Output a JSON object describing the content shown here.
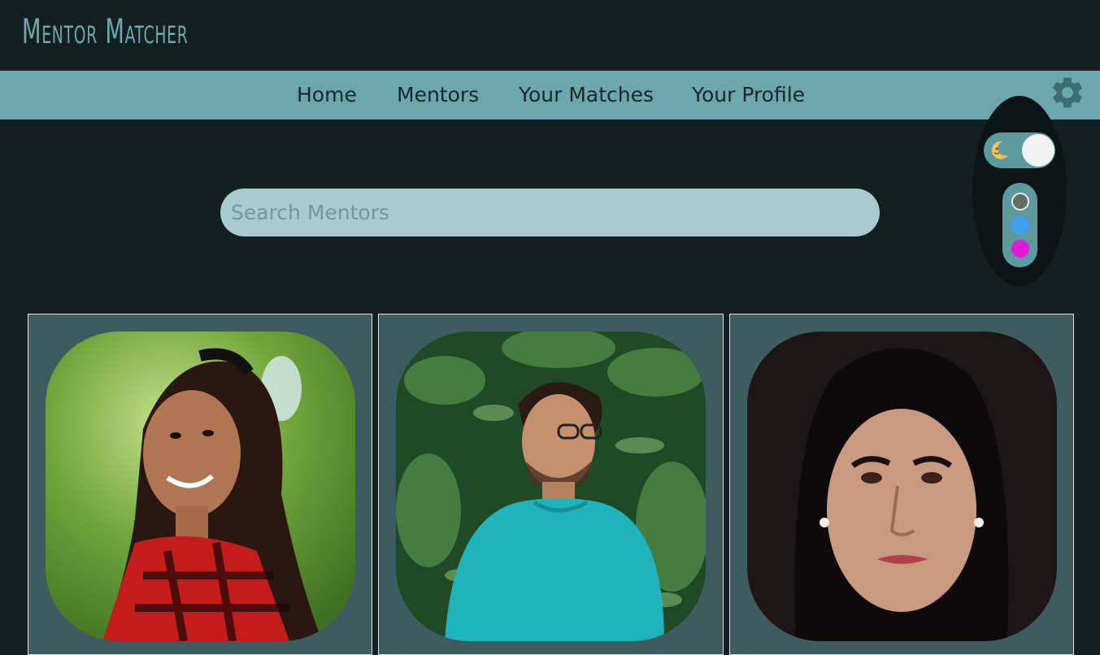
{
  "app": {
    "title": "Mentor Matcher"
  },
  "nav": {
    "items": [
      {
        "label": "Home"
      },
      {
        "label": "Mentors"
      },
      {
        "label": "Your Matches"
      },
      {
        "label": "Your Profile"
      }
    ]
  },
  "settings": {
    "icon": "gear-icon",
    "theme_toggle": {
      "icon": "moon-icon",
      "mode": "dark",
      "on": true
    },
    "color_swatches": [
      {
        "name": "gray-green",
        "color": "#5f6e62",
        "selected": true
      },
      {
        "name": "blue",
        "color": "#3fa0f2",
        "selected": false
      },
      {
        "name": "magenta",
        "color": "#e01ad8",
        "selected": false
      }
    ]
  },
  "search": {
    "placeholder": "Search Mentors",
    "value": ""
  },
  "colors": {
    "background": "#131f21",
    "nav_background": "#6ca7ad",
    "title_color": "#6fa8ae",
    "card_background": "#3e5b60",
    "search_background": "#a9cbcf"
  },
  "mentors": [
    {
      "photo": "mentor-photo-woman-red-plaid-shirt"
    },
    {
      "photo": "mentor-photo-man-teal-shirt-glasses"
    },
    {
      "photo": "mentor-photo-woman-dark-background"
    }
  ]
}
